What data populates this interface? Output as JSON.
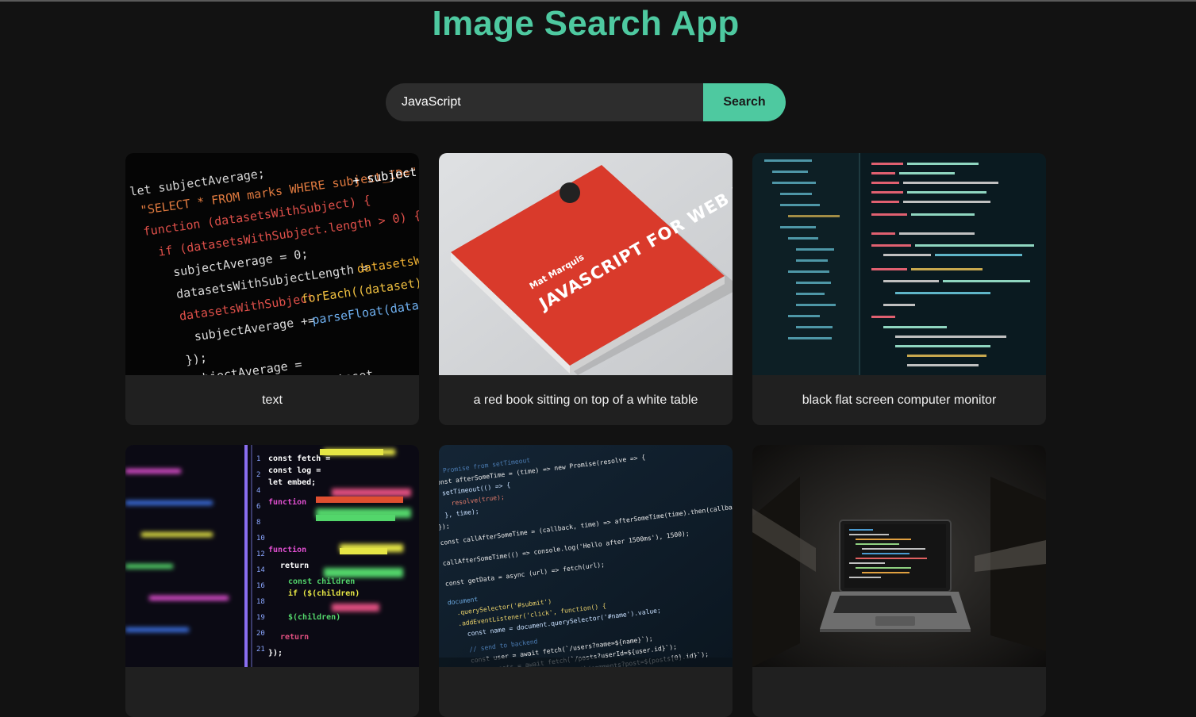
{
  "header": {
    "title": "Image Search App"
  },
  "search": {
    "value": "JavaScript",
    "button_label": "Search"
  },
  "results": [
    {
      "caption": "text"
    },
    {
      "caption": "a red book sitting on top of a white table",
      "book_title": "JAVASCRIPT FOR WEB DESIGNERS",
      "book_author": "Mat Marquis"
    },
    {
      "caption": "black flat screen computer monitor"
    },
    {
      "caption": ""
    },
    {
      "caption": ""
    },
    {
      "caption": ""
    }
  ],
  "colors": {
    "accent": "#4ec9a0",
    "background": "#121212",
    "card": "#202020",
    "input": "#2d2d2d"
  }
}
